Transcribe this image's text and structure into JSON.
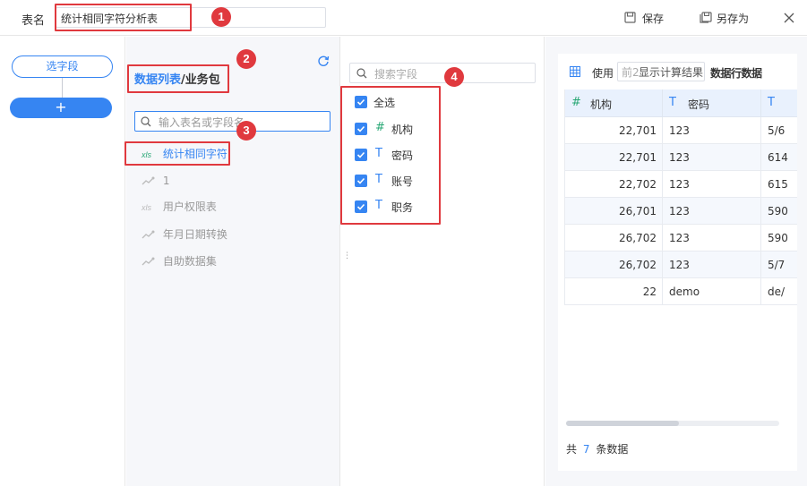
{
  "header": {
    "name_label": "表名",
    "name_value": "统计相同字符分析表",
    "save_label": "保存",
    "save_as_label": "另存为"
  },
  "left_panel": {
    "select_fields_label": "选字段",
    "add_label": "+"
  },
  "tables_panel": {
    "tab_data_list": "数据列表",
    "tab_separator": "/",
    "tab_business_pack": "业务包",
    "search_placeholder": "输入表名或字段名",
    "items": [
      {
        "label": "统计相同字符",
        "icon": "xls-icon",
        "selected": true
      },
      {
        "label": "1",
        "icon": "dataset-icon",
        "selected": false
      },
      {
        "label": "用户权限表",
        "icon": "xls-icon",
        "selected": false
      },
      {
        "label": "年月日期转换",
        "icon": "dataset-icon",
        "selected": false
      },
      {
        "label": "自助数据集",
        "icon": "dataset-icon",
        "selected": false
      }
    ]
  },
  "fields_panel": {
    "search_placeholder": "搜索字段",
    "select_all_label": "全选",
    "fields": [
      {
        "type": "#",
        "label": "机构",
        "checked": true
      },
      {
        "type": "T",
        "label": "密码",
        "checked": true
      },
      {
        "type": "T",
        "label": "账号",
        "checked": true
      },
      {
        "type": "T",
        "label": "职务",
        "checked": true
      }
    ]
  },
  "preview": {
    "toolbar_use": "使用",
    "toolbar_front_input": "前2",
    "toolbar_show_calc": "显示计算结果",
    "toolbar_data_rows": "数据行数据",
    "columns": [
      {
        "type": "#",
        "label": "机构"
      },
      {
        "type": "T",
        "label": "密码"
      },
      {
        "type": "T",
        "label": ""
      }
    ],
    "rows": [
      [
        "22,701",
        "123",
        "5/6"
      ],
      [
        "22,701",
        "123",
        "614"
      ],
      [
        "22,702",
        "123",
        "615"
      ],
      [
        "26,701",
        "123",
        "590"
      ],
      [
        "26,702",
        "123",
        "590"
      ],
      [
        "26,702",
        "123",
        "5/7"
      ],
      [
        "22",
        "demo",
        "de/"
      ]
    ],
    "footer_prefix": "共",
    "footer_count": "7",
    "footer_suffix": "条数据"
  },
  "annotations": [
    "1",
    "2",
    "3",
    "4"
  ],
  "colors": {
    "accent": "#3685f2",
    "annotation_red": "#e0393e",
    "excel_green": "#2aa876"
  }
}
